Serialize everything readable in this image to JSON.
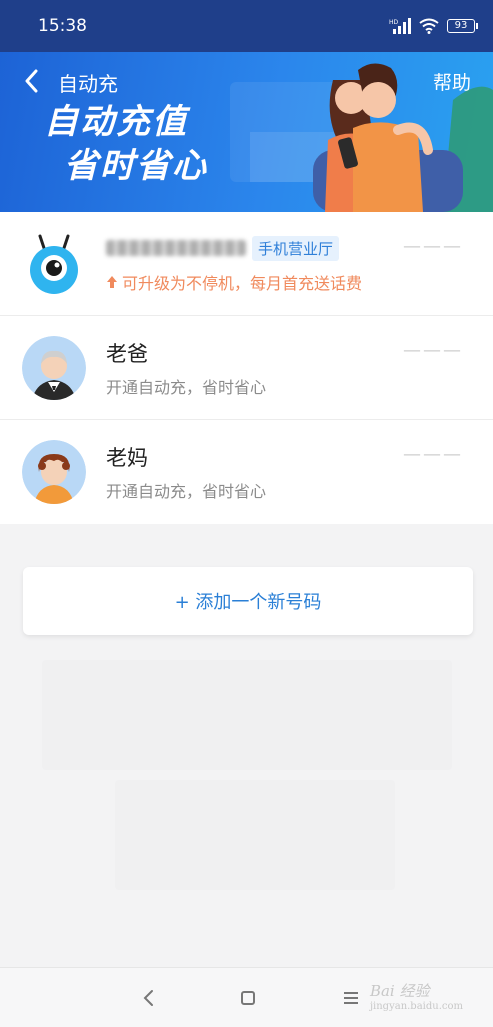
{
  "status_bar": {
    "time": "15:38",
    "network": "HD",
    "battery": "93"
  },
  "header": {
    "title": "自动充",
    "help_label": "帮助",
    "slogan_line1": "自动充值",
    "slogan_line2": "省时省心"
  },
  "accounts": [
    {
      "title": "",
      "tag": "手机营业厅",
      "subtitle": "可升级为不停机，每月首充送话费",
      "more": "———"
    },
    {
      "title": "老爸",
      "subtitle": "开通自动充，省时省心",
      "more": "———"
    },
    {
      "title": "老妈",
      "subtitle": "开通自动充，省时省心",
      "more": "———"
    }
  ],
  "add_number_label": "+ 添加一个新号码",
  "watermark": {
    "brand": "Bai 经验",
    "url": "jingyan.baidu.com"
  },
  "colors": {
    "accent": "#2a7fd6",
    "banner_start": "#1d63d6",
    "banner_end": "#2aa2f0",
    "promo": "#f08a5d"
  }
}
